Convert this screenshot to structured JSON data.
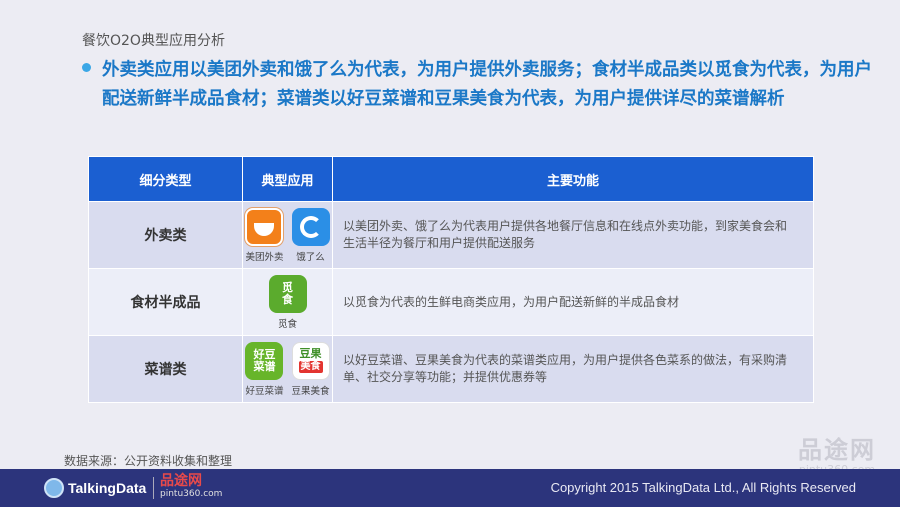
{
  "page_title": "餐饮O2O典型应用分析",
  "headline": {
    "line1": "外卖类应用以美团外卖和饿了么为代表，为用户提供外卖服务；食材半成品类以觅食为代表，为用户",
    "line2": "配送新鲜半成品食材；菜谱类以好豆菜谱和豆果美食为代表，为用户提供详尽的菜谱解析"
  },
  "table": {
    "headers": {
      "type": "细分类型",
      "apps": "典型应用",
      "features": "主要功能"
    },
    "rows": [
      {
        "type": "外卖类",
        "apps": [
          {
            "name": "美团外卖",
            "icon": "meituan-waimai-icon"
          },
          {
            "name": "饿了么",
            "icon": "eleme-icon"
          }
        ],
        "desc_line1": "以美团外卖、饿了么为代表用户提供各地餐厅信息和在线点外卖功能，到家美食会和",
        "desc_line2": "生活半径为餐厅和用户提供配送服务"
      },
      {
        "type": "食材半成品",
        "apps": [
          {
            "name": "觅食",
            "icon": "mishi-icon",
            "glyph": "觅\n食"
          }
        ],
        "desc_line1": "以觅食为代表的生鲜电商类应用，为用户配送新鲜的半成品食材",
        "desc_line2": ""
      },
      {
        "type": "菜谱类",
        "apps": [
          {
            "name": "好豆菜谱",
            "icon": "haodou-icon",
            "glyph1": "好豆",
            "glyph2": "菜谱"
          },
          {
            "name": "豆果美食",
            "icon": "douguo-icon",
            "glyph1": "豆果",
            "glyph2": "美食"
          }
        ],
        "desc_line1": "以好豆菜谱、豆果美食为代表的菜谱类应用，为用户提供各色菜系的做法，有采购清",
        "desc_line2": "单、社交分享等功能；并提供优惠券等"
      }
    ]
  },
  "source": "数据来源：公开资料收集和整理",
  "footer": {
    "brand": "TalkingData",
    "partner_cn": "品途网",
    "partner_url": "pintu360.com",
    "copyright": "Copyright 2015 TalkingData Ltd., All Rights Reserved"
  },
  "watermark": {
    "cn": "品途网",
    "url": "pintu360.com"
  },
  "colors": {
    "header_bg": "#1b5fd1",
    "headline_text": "#1b78c7",
    "row_bg": "#d9dcef",
    "row_alt_bg": "#eceef8",
    "footer_bg": "#2c347c"
  }
}
